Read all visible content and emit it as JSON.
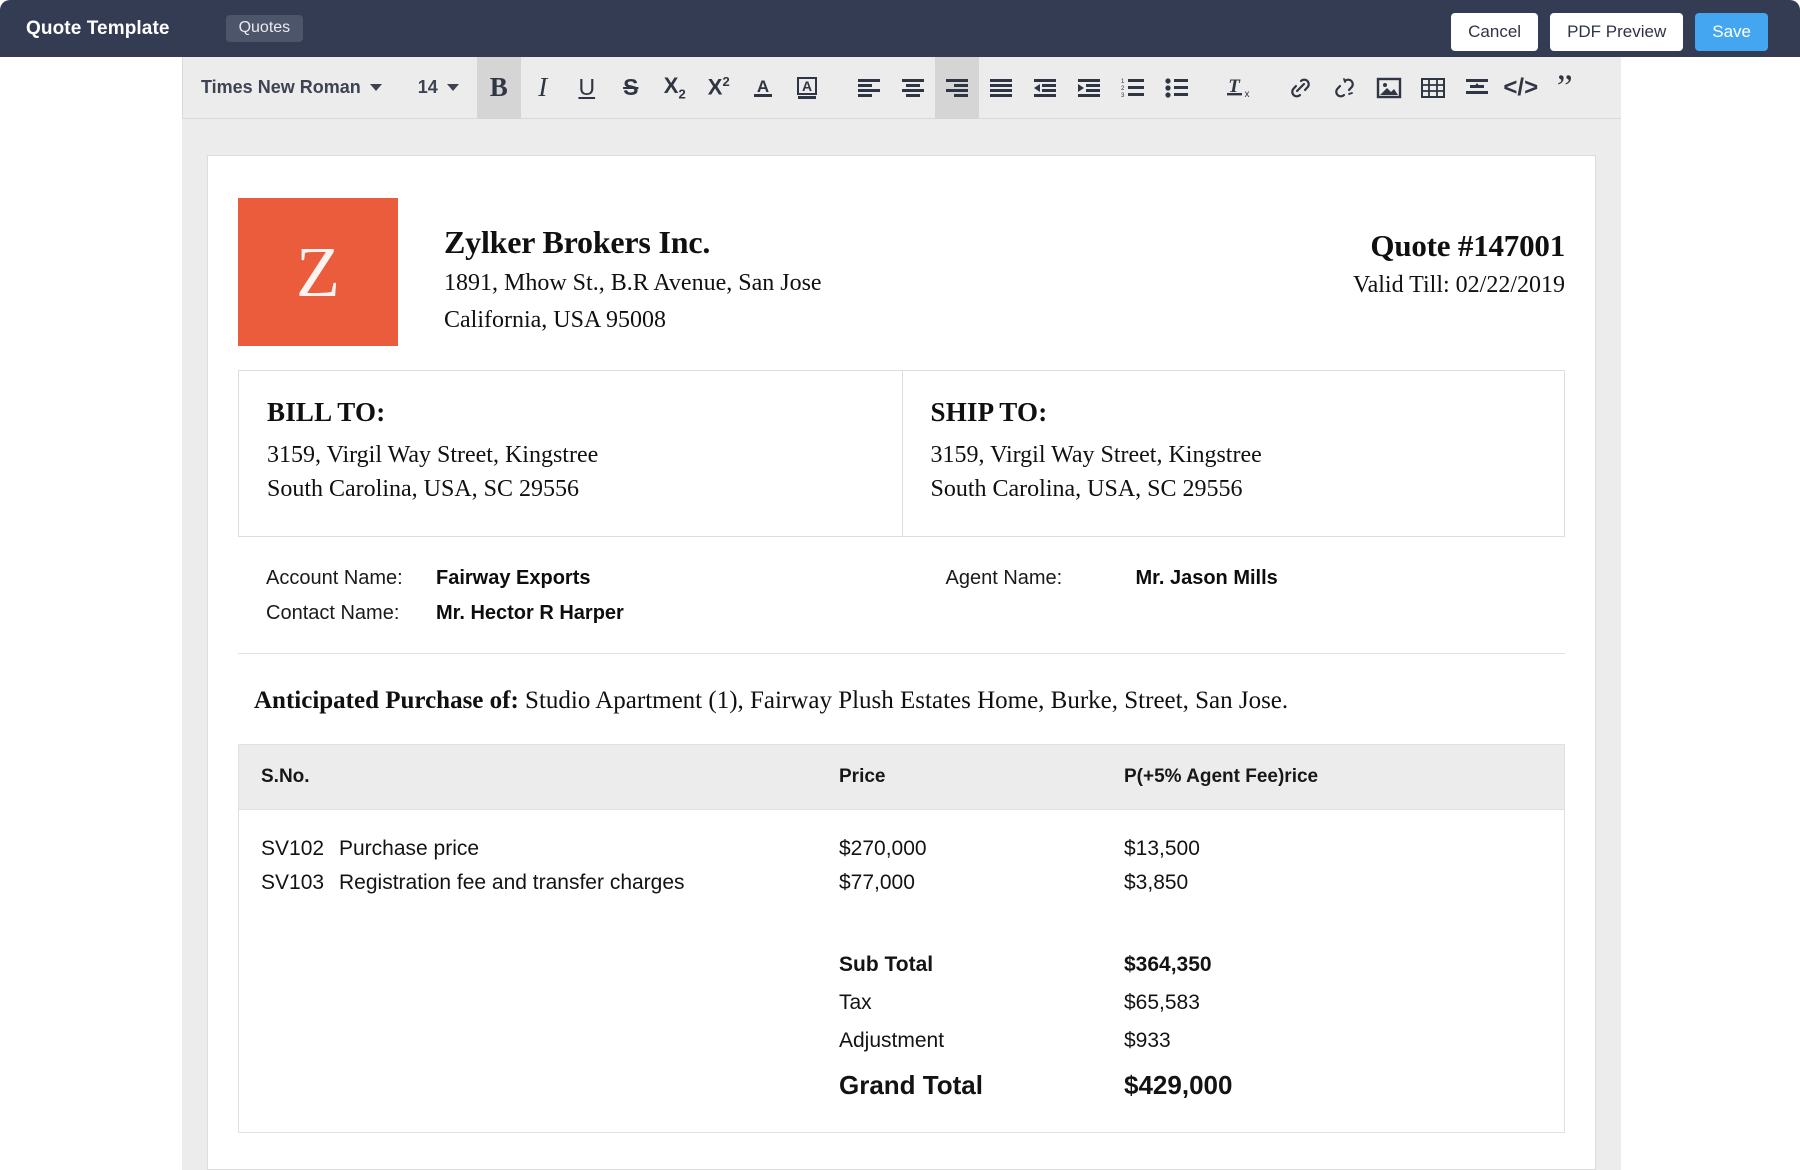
{
  "topbar": {
    "title": "Quote Template",
    "chip": "Quotes",
    "cancel_label": "Cancel",
    "pdf_preview_label": "PDF Preview",
    "save_label": "Save",
    "bg_color": "#333c52",
    "save_color": "#44a6f0"
  },
  "toolbar": {
    "font_family_value": "Times New Roman",
    "font_size_value": "14",
    "buttons": [
      {
        "name": "bold",
        "label": "B",
        "active": true
      },
      {
        "name": "italic",
        "label": "I",
        "active": false
      },
      {
        "name": "underline",
        "label": "U",
        "active": false
      },
      {
        "name": "strikethrough",
        "label": "S",
        "active": false
      },
      {
        "name": "subscript",
        "label": "X₂",
        "active": false
      },
      {
        "name": "superscript",
        "label": "X²",
        "active": false
      },
      {
        "name": "text-color",
        "label": "A",
        "active": false
      },
      {
        "name": "highlight-color",
        "label": "A",
        "active": false
      },
      {
        "name": "align-left",
        "label": "",
        "active": false
      },
      {
        "name": "align-center",
        "label": "",
        "active": false
      },
      {
        "name": "align-right",
        "label": "",
        "active": true
      },
      {
        "name": "align-justify",
        "label": "",
        "active": false
      },
      {
        "name": "outdent",
        "label": "",
        "active": false
      },
      {
        "name": "indent",
        "label": "",
        "active": false
      },
      {
        "name": "numbered-list",
        "label": "",
        "active": false
      },
      {
        "name": "bulleted-list",
        "label": "",
        "active": false
      },
      {
        "name": "clear-formatting",
        "label": "",
        "active": false
      },
      {
        "name": "insert-link",
        "label": "",
        "active": false
      },
      {
        "name": "remove-link",
        "label": "",
        "active": false
      },
      {
        "name": "insert-image",
        "label": "",
        "active": false
      },
      {
        "name": "insert-table",
        "label": "",
        "active": false
      },
      {
        "name": "line-height",
        "label": "",
        "active": false
      },
      {
        "name": "source-code",
        "label": "</>",
        "active": false
      },
      {
        "name": "blockquote",
        "label": "”",
        "active": false
      }
    ]
  },
  "document": {
    "logo_letter": "Z",
    "logo_color": "#ea5c3c",
    "company_name": "Zylker Brokers Inc.",
    "company_address_line1": "1891, Mhow St., B.R Avenue, San Jose",
    "company_address_line2": "California, USA 95008",
    "quote_number": "Quote #147001",
    "valid_till": "Valid Till: 02/22/2019",
    "bill_to": {
      "title": "BILL TO:",
      "line1": "3159, Virgil Way Street, Kingstree",
      "line2": "South Carolina, USA, SC 29556"
    },
    "ship_to": {
      "title": "SHIP TO:",
      "line1": "3159, Virgil Way Street, Kingstree",
      "line2": "South Carolina, USA, SC 29556"
    },
    "fields": {
      "account_name_label": "Account Name:",
      "account_name_value": "Fairway Exports",
      "contact_name_label": "Contact Name:",
      "contact_name_value": "Mr. Hector R Harper",
      "agent_name_label": "Agent Name:",
      "agent_name_value": "Mr. Jason Mills"
    },
    "anticipated_label": "Anticipated Purchase of:",
    "anticipated_value": "Studio Apartment (1), Fairway Plush Estates Home, Burke, Street, San Jose.",
    "table": {
      "headers": {
        "sno": "S.No.",
        "description": "",
        "price": "Price",
        "fee_price": "P(+5% Agent Fee)rice"
      },
      "rows": [
        {
          "sno": "SV102",
          "description": "Purchase price",
          "price": "$270,000",
          "fee_price": "$13,500"
        },
        {
          "sno": "SV103",
          "description": "Registration fee and transfer charges",
          "price": "$77,000",
          "fee_price": "$3,850"
        }
      ],
      "totals": [
        {
          "label": "Sub Total",
          "value": "$364,350",
          "bold": true
        },
        {
          "label": "Tax",
          "value": "$65,583",
          "bold": false
        },
        {
          "label": "Adjustment",
          "value": "$933",
          "bold": false
        }
      ],
      "grand_total_label": "Grand Total",
      "grand_total_value": "$429,000"
    }
  }
}
